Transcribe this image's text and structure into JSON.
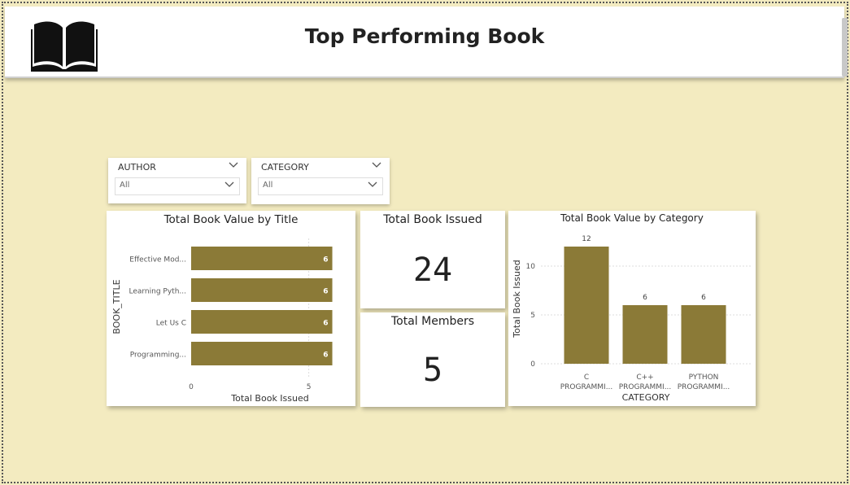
{
  "header": {
    "title": "Top Performing Book"
  },
  "slicers": [
    {
      "label": "AUTHOR",
      "value": "All"
    },
    {
      "label": "CATEGORY",
      "value": "All"
    }
  ],
  "kpis": {
    "issued": {
      "title": "Total Book Issued",
      "value": "24"
    },
    "members": {
      "title": "Total Members",
      "value": "5"
    }
  },
  "chart_data": [
    {
      "type": "bar",
      "orientation": "horizontal",
      "title": "Total Book Value by Title",
      "xlabel": "Total Book Issued",
      "ylabel": "BOOK_TITLE",
      "categories": [
        "Effective Mod...",
        "Learning Pyth...",
        "Let Us C",
        "Programming..."
      ],
      "values": [
        6,
        6,
        6,
        6
      ],
      "data_labels": [
        "6",
        "6",
        "6",
        "6"
      ],
      "xticks": [
        "0",
        "5"
      ],
      "xlim": [
        0,
        6.5
      ],
      "bar_color": "#8b7a37",
      "grid": false
    },
    {
      "type": "bar",
      "orientation": "vertical",
      "title": "Total Book Value by Category",
      "xlabel": "CATEGORY",
      "ylabel": "Total Book Issued",
      "categories": [
        [
          "C",
          "PROGRAMMI..."
        ],
        [
          "C++",
          "PROGRAMMI..."
        ],
        [
          "PYTHON",
          "PROGRAMMI..."
        ]
      ],
      "values": [
        12,
        6,
        6
      ],
      "data_labels": [
        "12",
        "6",
        "6"
      ],
      "yticks": [
        "0",
        "5",
        "10"
      ],
      "ylim": [
        0,
        12
      ],
      "bar_color": "#8b7a37",
      "grid": true
    }
  ],
  "colors": {
    "background": "#f3ebc0",
    "bar": "#8b7a37",
    "header_bg": "#ffffff"
  },
  "icons": [
    "open-book-icon",
    "chevron-down-icon"
  ]
}
